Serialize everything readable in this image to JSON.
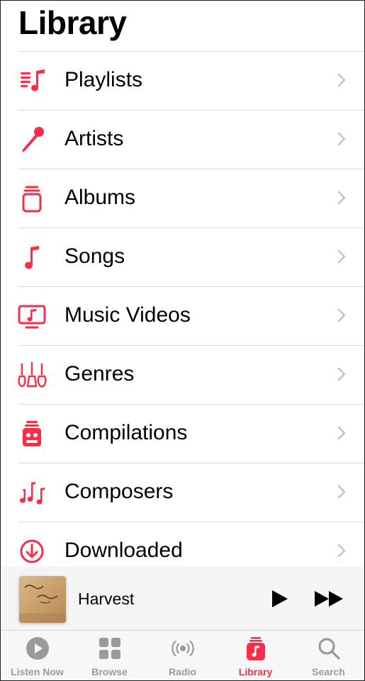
{
  "header": {
    "title": "Library"
  },
  "accent_color": "#fa2d48",
  "library_items": [
    {
      "label": "Playlists",
      "icon": "playlist-icon"
    },
    {
      "label": "Artists",
      "icon": "microphone-icon"
    },
    {
      "label": "Albums",
      "icon": "album-stack-icon"
    },
    {
      "label": "Songs",
      "icon": "music-note-icon"
    },
    {
      "label": "Music Videos",
      "icon": "music-video-icon"
    },
    {
      "label": "Genres",
      "icon": "guitars-icon"
    },
    {
      "label": "Compilations",
      "icon": "compilation-icon"
    },
    {
      "label": "Composers",
      "icon": "composer-notes-icon"
    },
    {
      "label": "Downloaded",
      "icon": "download-icon"
    }
  ],
  "mini_player": {
    "song_title": "Harvest",
    "artwork": "album-artwork",
    "play_icon": "play-icon",
    "next_icon": "fast-forward-icon"
  },
  "tab_bar": {
    "tabs": [
      {
        "label": "Listen Now",
        "icon": "listen-now-icon",
        "active": false
      },
      {
        "label": "Browse",
        "icon": "browse-grid-icon",
        "active": false
      },
      {
        "label": "Radio",
        "icon": "radio-icon",
        "active": false
      },
      {
        "label": "Library",
        "icon": "library-icon",
        "active": true
      },
      {
        "label": "Search",
        "icon": "search-icon",
        "active": false
      }
    ]
  }
}
